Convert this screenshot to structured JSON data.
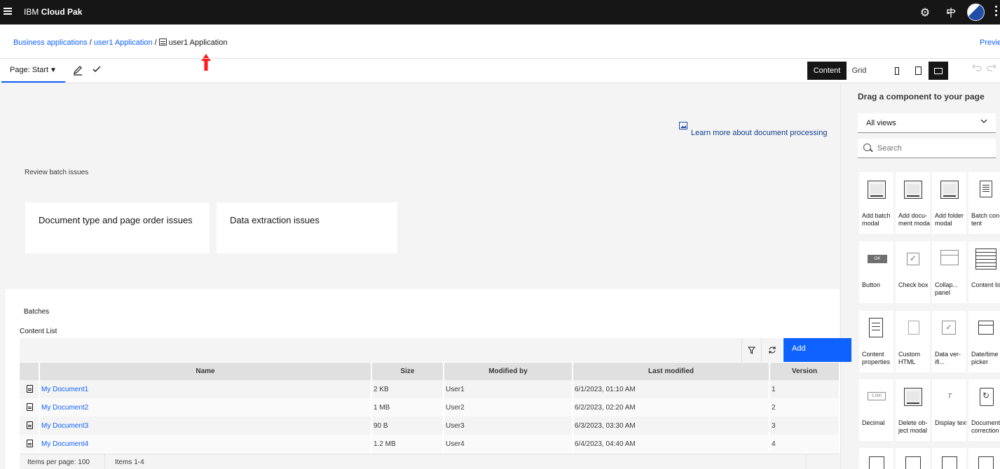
{
  "topbar": {
    "brand_prefix": "IBM",
    "brand_name": "Cloud Pak",
    "icons": [
      "menu-icon",
      "settings-icon",
      "signpost-icon",
      "avatar",
      "overflow-menu-icon"
    ]
  },
  "breadcrumb": {
    "items": [
      {
        "label": "Business applications",
        "link": true
      },
      {
        "label": "user1 Application",
        "link": true
      },
      {
        "label": "user1 Application",
        "link": false,
        "icon": "table-icon"
      }
    ],
    "separator": "/"
  },
  "preview_label": "Previe",
  "toolbar": {
    "page_prefix": "Page:",
    "page_value": "Start",
    "view_modes": [
      "Content",
      "Grid"
    ],
    "active_view": "Content",
    "devices": [
      "phone-icon",
      "tablet-icon",
      "desktop-icon"
    ],
    "active_device": "desktop-icon"
  },
  "canvas": {
    "learn_more": "Learn more about document processing",
    "review_label": "Review batch issues",
    "tiles": [
      "Document type and page order issues",
      "Data extraction issues"
    ],
    "batches_label": "Batches",
    "content_list_label": "Content List",
    "add_label": "Add",
    "table": {
      "columns": [
        "Name",
        "Size",
        "Modified by",
        "Last modified",
        "Version"
      ],
      "rows": [
        {
          "name": "My Document1",
          "size": "2 KB",
          "modified_by": "User1",
          "last_modified": "6/1/2023, 01:10 AM",
          "version": "1"
        },
        {
          "name": "My Document2",
          "size": "1 MB",
          "modified_by": "User2",
          "last_modified": "6/2/2023, 02:20 AM",
          "version": "2"
        },
        {
          "name": "My Document3",
          "size": "90 B",
          "modified_by": "User3",
          "last_modified": "6/3/2023, 03:30 AM",
          "version": "3"
        },
        {
          "name": "My Document4",
          "size": "1.2 MB",
          "modified_by": "User4",
          "last_modified": "6/4/2023, 04:40 AM",
          "version": "4"
        }
      ]
    },
    "pager": {
      "items_per_page": "Items per page: 100",
      "items_range": "Items 1-4"
    }
  },
  "palette": {
    "title": "Drag a component to your page",
    "views_value": "All views",
    "search_placeholder": "Search",
    "components": [
      {
        "label": "Add batch modal",
        "icon": "modal-icon"
      },
      {
        "label": "Add docu-ment modal",
        "icon": "modal-icon"
      },
      {
        "label": "Add folder modal",
        "icon": "modal-icon"
      },
      {
        "label": "Batch con-tent",
        "icon": "documents-icon"
      },
      {
        "label": "Button",
        "icon": "button-icon",
        "glyph_text": "OK"
      },
      {
        "label": "Check box",
        "icon": "checkbox-icon"
      },
      {
        "label": "Collap... panel",
        "icon": "collapsible-panel-icon"
      },
      {
        "label": "Content list",
        "icon": "list-icon"
      },
      {
        "label": "Content properties",
        "icon": "properties-icon"
      },
      {
        "label": "Custom HTML",
        "icon": "html-icon"
      },
      {
        "label": "Data ver-ifi...",
        "icon": "shield-icon"
      },
      {
        "label": "Date/time picker",
        "icon": "calendar-icon"
      },
      {
        "label": "Decimal",
        "icon": "decimal-icon",
        "glyph_text": "3.890"
      },
      {
        "label": "Delete ob-ject modal",
        "icon": "modal-icon"
      },
      {
        "label": "Display text",
        "icon": "text-icon",
        "glyph_text": "T"
      },
      {
        "label": "Document correction",
        "icon": "document-correction-icon"
      }
    ]
  }
}
